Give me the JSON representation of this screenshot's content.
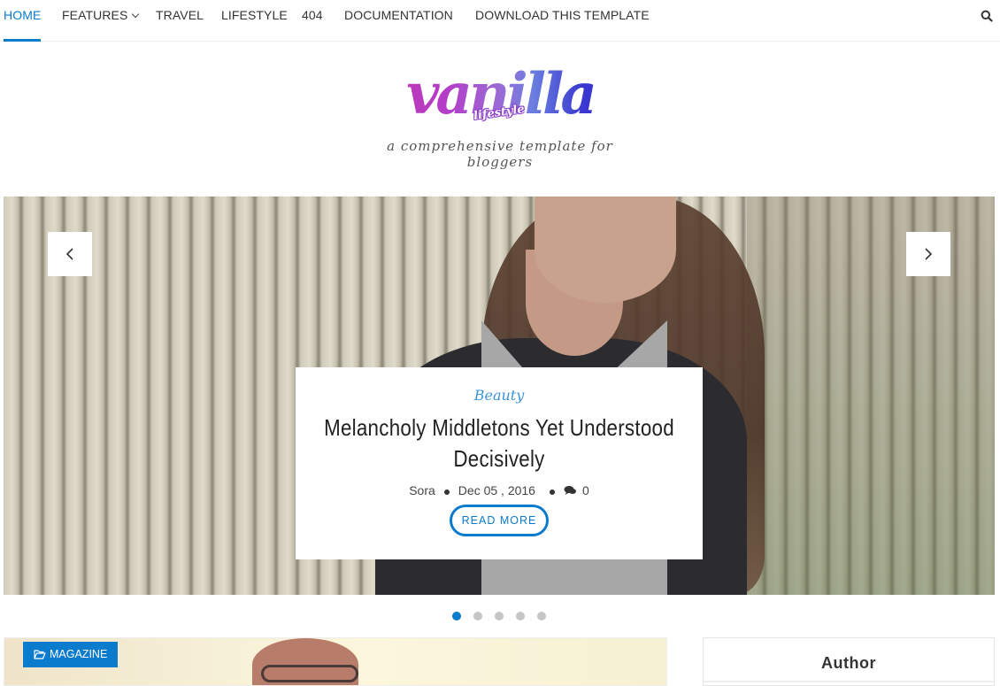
{
  "nav": {
    "items": [
      {
        "label": "HOME",
        "active": true
      },
      {
        "label": "FEATURES",
        "has_dropdown": true
      },
      {
        "label": "TRAVEL"
      },
      {
        "label": "LIFESTYLE"
      },
      {
        "label": "404"
      },
      {
        "label": "DOCUMENTATION"
      },
      {
        "label": "DOWNLOAD THIS TEMPLATE"
      }
    ],
    "search_icon": "search-icon"
  },
  "header": {
    "logo_text": "vanilla",
    "logo_subtext": "lifestyle",
    "tagline": "a comprehensive template for bloggers"
  },
  "slider": {
    "prev_icon": "chevron-left-icon",
    "next_icon": "chevron-right-icon",
    "slide": {
      "category": "Beauty",
      "title": "Melancholy Middletons Yet Understood Decisively",
      "author": "Sora",
      "date": "Dec 05 , 2016",
      "comments": "0",
      "read_more": "READ MORE"
    },
    "total_slides": 5,
    "active_slide": 1
  },
  "featured": {
    "badge": "MAGAZINE",
    "badge_icon": "folder-open-icon"
  },
  "sidebar": {
    "author_title": "Author"
  },
  "colors": {
    "accent": "#0a7bcd",
    "category": "#3b95d8",
    "inactive_dot": "#c6c6c6"
  }
}
